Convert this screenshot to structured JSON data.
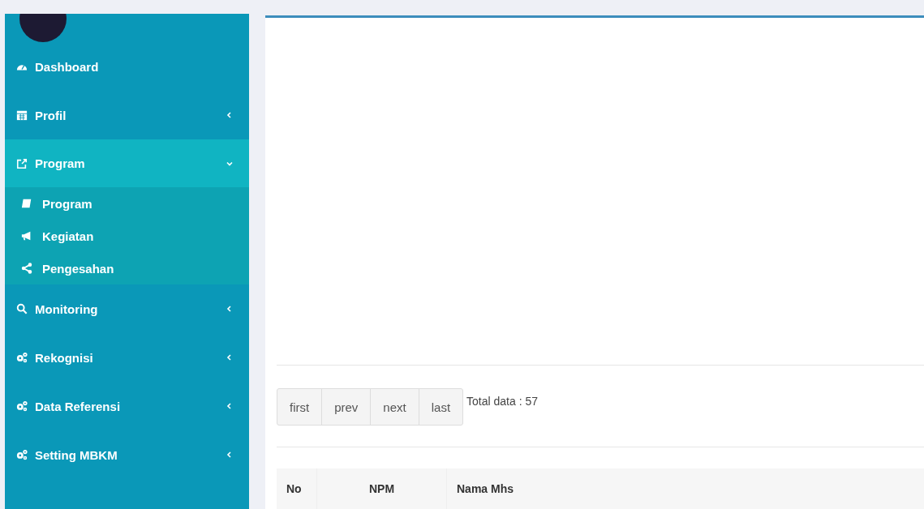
{
  "sidebar": {
    "items": [
      {
        "kind": "link",
        "label": "Dashboard",
        "selected": false
      },
      {
        "kind": "menu",
        "label": "Profil",
        "selected": false,
        "expanded": false
      },
      {
        "kind": "menu",
        "label": "Program",
        "selected": true,
        "expanded": true,
        "children": [
          {
            "label": "Program",
            "selected": false
          },
          {
            "label": "Kegiatan",
            "selected": false
          },
          {
            "label": "Pengesahan",
            "selected": false
          }
        ]
      },
      {
        "kind": "menu",
        "label": "Monitoring",
        "selected": false,
        "expanded": false
      },
      {
        "kind": "menu",
        "label": "Rekognisi",
        "selected": false,
        "expanded": false
      },
      {
        "kind": "menu",
        "label": "Data Referensi",
        "selected": false,
        "expanded": false
      },
      {
        "kind": "menu",
        "label": "Setting MBKM",
        "selected": false,
        "expanded": false
      }
    ]
  },
  "pagination": {
    "buttons": [
      "first",
      "prev",
      "next",
      "last"
    ],
    "total": "Total data : 57"
  },
  "table": {
    "columns": [
      "No",
      "NPM",
      "Nama Mhs"
    ]
  }
}
